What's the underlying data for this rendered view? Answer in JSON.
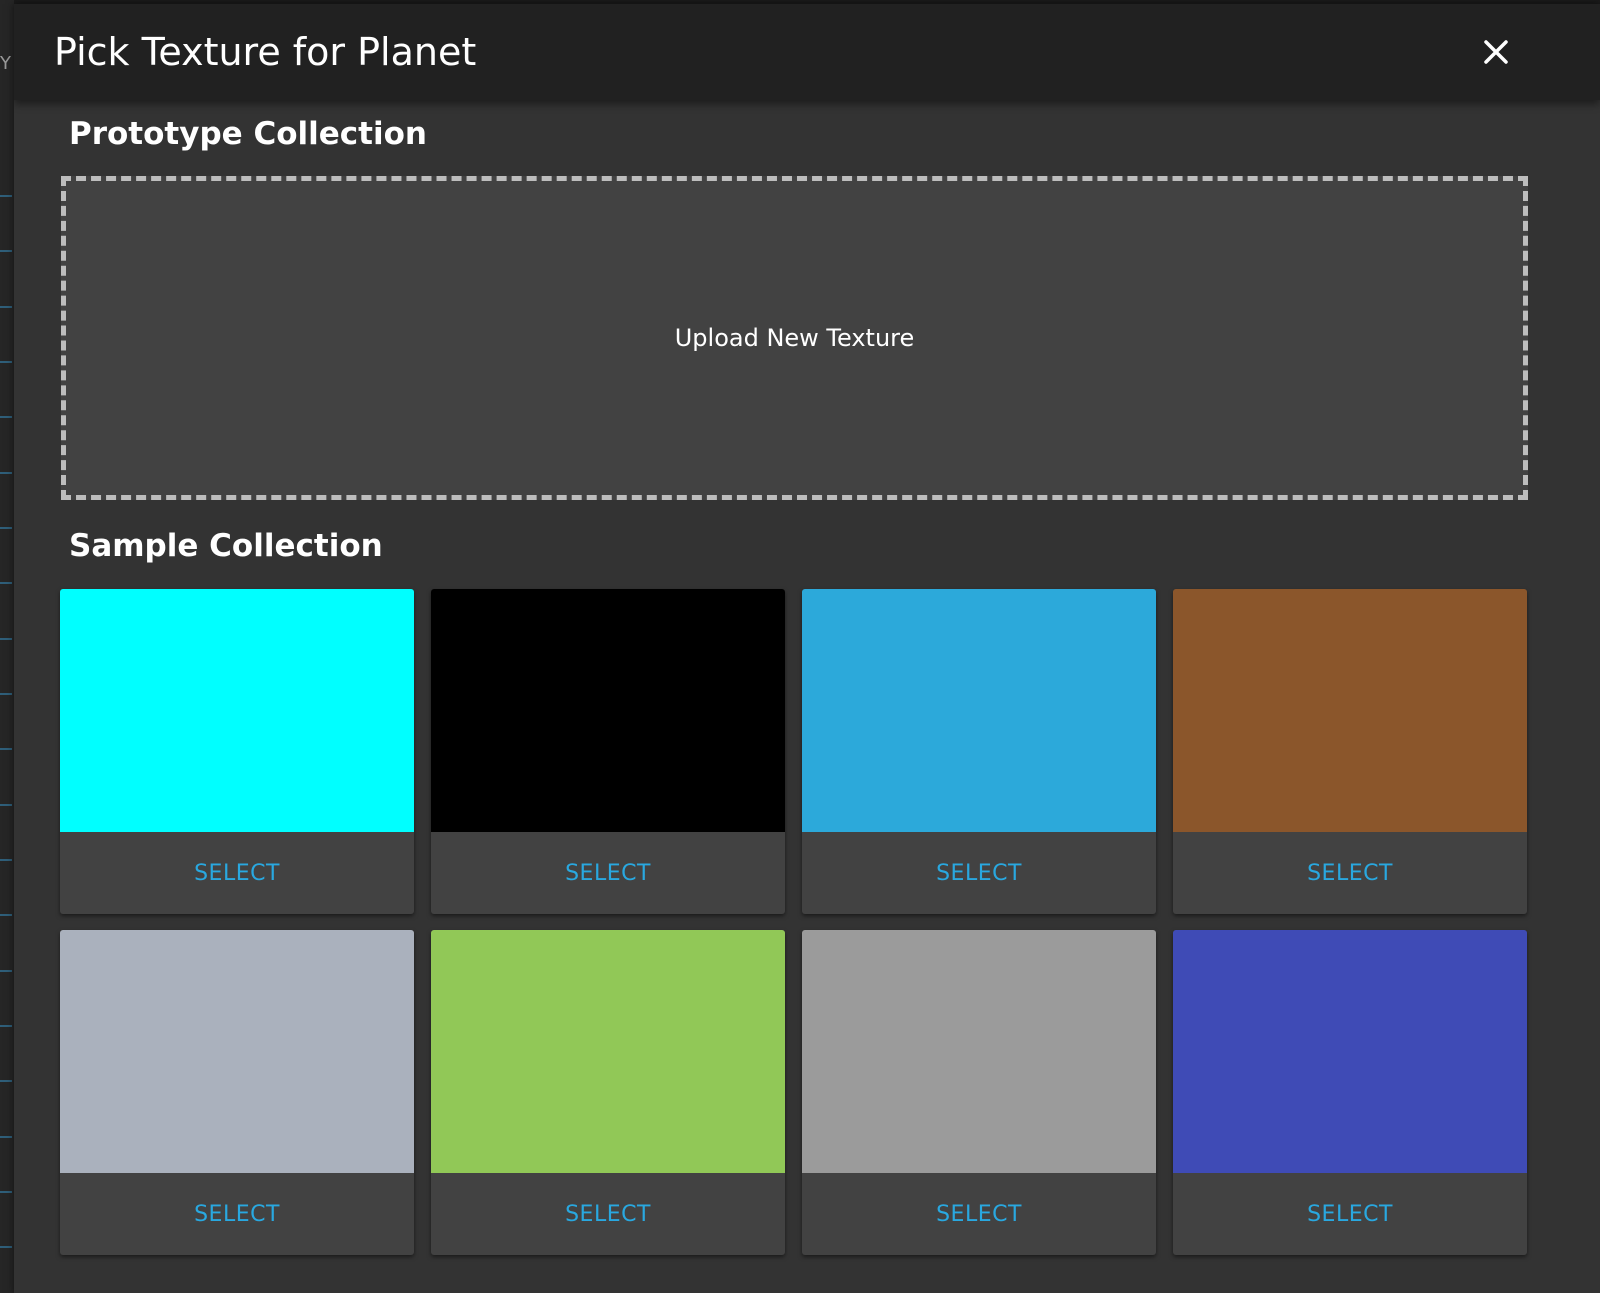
{
  "dialog": {
    "title": "Pick Texture for Planet",
    "close_icon": "close-icon"
  },
  "background": {
    "partial_letter": "Y"
  },
  "prototype_collection": {
    "title": "Prototype Collection",
    "upload_label": "Upload New Texture"
  },
  "sample_collection": {
    "title": "Sample Collection",
    "cards": [
      {
        "color": "#00ffff",
        "select_label": "SELECT"
      },
      {
        "color": "#000000",
        "select_label": "SELECT"
      },
      {
        "color": "#2ca9da",
        "select_label": "SELECT"
      },
      {
        "color": "#8b562b",
        "select_label": "SELECT"
      },
      {
        "color": "#aab1bd",
        "select_label": "SELECT"
      },
      {
        "color": "#91c857",
        "select_label": "SELECT"
      },
      {
        "color": "#9b9b9b",
        "select_label": "SELECT"
      },
      {
        "color": "#3f4bb6",
        "select_label": "SELECT"
      }
    ]
  },
  "colors": {
    "accent": "#29a8e0",
    "dialog_bg": "#333333",
    "header_bg": "#212121",
    "card_bg": "#424242"
  }
}
